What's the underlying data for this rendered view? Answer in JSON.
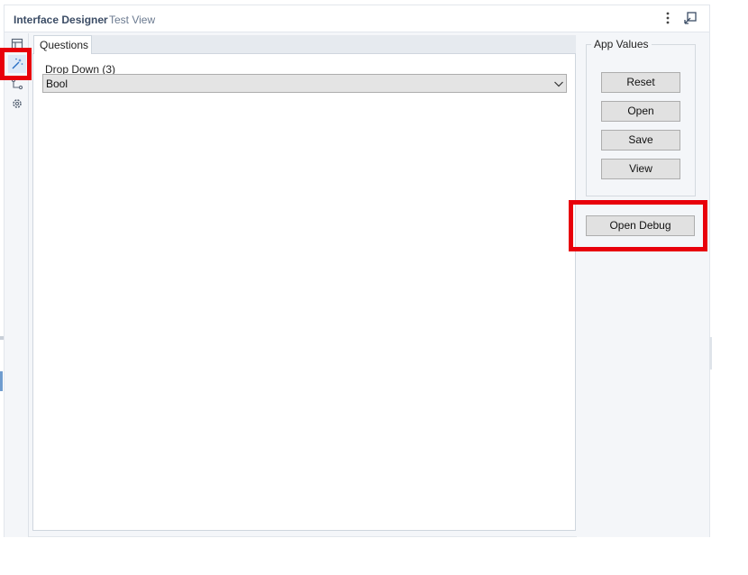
{
  "window": {
    "title": "Interface Designer",
    "separator": "-",
    "subtitle": "Test View",
    "accent_color": "#3c4d66"
  },
  "left_toolbar": {
    "icons": [
      "layout-icon",
      "magic-wand-icon",
      "tree-icon",
      "gear-icon"
    ],
    "selected": "magic-wand-icon"
  },
  "tabs": [
    {
      "label": "Questions",
      "selected": true
    }
  ],
  "questions": {
    "dropdown": {
      "label": "Drop Down (3)",
      "value": "Bool"
    }
  },
  "app_values": {
    "title": "App Values",
    "buttons": {
      "reset": "Reset",
      "open": "Open",
      "save": "Save",
      "view": "View"
    }
  },
  "debug": {
    "button_label": "Open Debug"
  },
  "highlight_color": "#e8000b"
}
